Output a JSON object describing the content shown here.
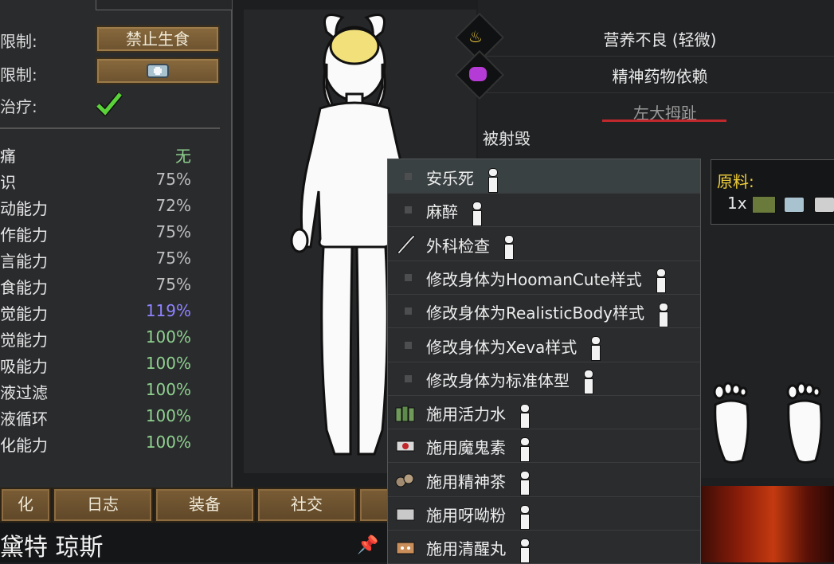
{
  "settings": {
    "food_label": "限制:",
    "food_value": "禁止生食",
    "medicine_label": "限制:",
    "treatment_label": "治疗:"
  },
  "capacities": [
    {
      "name": "痛",
      "value": "无",
      "color": "#8fd18f"
    },
    {
      "name": "识",
      "value": "75%",
      "color": "#bfbfbf"
    },
    {
      "name": "动能力",
      "value": "72%",
      "color": "#bfbfbf"
    },
    {
      "name": "作能力",
      "value": "75%",
      "color": "#bfbfbf"
    },
    {
      "name": "言能力",
      "value": "75%",
      "color": "#bfbfbf"
    },
    {
      "name": "食能力",
      "value": "75%",
      "color": "#bfbfbf"
    },
    {
      "name": "觉能力",
      "value": "119%",
      "color": "#8f83ff"
    },
    {
      "name": "觉能力",
      "value": "100%",
      "color": "#8fd18f"
    },
    {
      "name": "吸能力",
      "value": "100%",
      "color": "#8fd18f"
    },
    {
      "name": "液过滤",
      "value": "100%",
      "color": "#8fd18f"
    },
    {
      "name": "液循环",
      "value": "100%",
      "color": "#8fd18f"
    },
    {
      "name": "化能力",
      "value": "100%",
      "color": "#8fd18f"
    }
  ],
  "bottom_tabs": [
    "化",
    "日志",
    "装备",
    "社交"
  ],
  "pawn_name": "黛特 琼斯",
  "conditions": [
    {
      "icon": "food-bowl-icon",
      "text": "营养不良 (轻微)"
    },
    {
      "icon": "pill-icon",
      "text": "精神药物依赖"
    }
  ],
  "part_title": "左大拇趾",
  "injury": "被射毁",
  "ingredients": {
    "title": "原料:",
    "qty": "1x"
  },
  "menu": [
    {
      "label": "安乐死",
      "icon": "bullet",
      "selected": true
    },
    {
      "label": "麻醉",
      "icon": "bullet"
    },
    {
      "label": "外科检查",
      "icon": "scalpel-icon"
    },
    {
      "label": "修改身体为HoomanCute样式",
      "icon": "bullet"
    },
    {
      "label": "修改身体为RealisticBody样式",
      "icon": "bullet"
    },
    {
      "label": "修改身体为Xeva样式",
      "icon": "bullet"
    },
    {
      "label": "修改身体为标准体型",
      "icon": "bullet"
    },
    {
      "label": "施用活力水",
      "icon": "bottles-icon"
    },
    {
      "label": "施用魔鬼素",
      "icon": "flake-icon"
    },
    {
      "label": "施用精神茶",
      "icon": "tea-icon"
    },
    {
      "label": "施用呀呦粉",
      "icon": "powder-icon"
    },
    {
      "label": "施用清醒丸",
      "icon": "pills-box-icon"
    }
  ],
  "colors": {
    "accent_yellow": "#f1cf3a",
    "good": "#8fd18f",
    "boosted": "#8f83ff",
    "underline_red": "#c0282d"
  }
}
